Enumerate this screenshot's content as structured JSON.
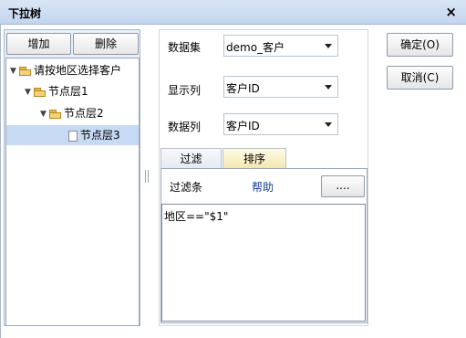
{
  "window": {
    "title": "下拉树",
    "close_glyph": "×"
  },
  "left": {
    "add_label": "增加",
    "delete_label": "删除",
    "tree": [
      {
        "label": "请按地区选择客户",
        "level": 0,
        "type": "folder",
        "expanded": true
      },
      {
        "label": "节点层1",
        "level": 1,
        "type": "folder",
        "expanded": true
      },
      {
        "label": "节点层2",
        "level": 2,
        "type": "folder",
        "expanded": true
      },
      {
        "label": "节点层3",
        "level": 3,
        "type": "file",
        "selected": true
      }
    ]
  },
  "form": {
    "dataset_label": "数据集",
    "dataset_value": "demo_客户",
    "display_label": "显示列",
    "display_value": "客户ID",
    "data_label": "数据列",
    "data_value": "客户ID"
  },
  "tabs": [
    {
      "label": "过滤",
      "active": false
    },
    {
      "label": "排序",
      "active": true
    }
  ],
  "filter": {
    "condition_label": "过滤条",
    "help_label": "帮助",
    "more_label": "....",
    "expression": "地区==\"$1\""
  },
  "actions": {
    "ok_label": "确定(O)",
    "cancel_label": "取消(C)"
  }
}
